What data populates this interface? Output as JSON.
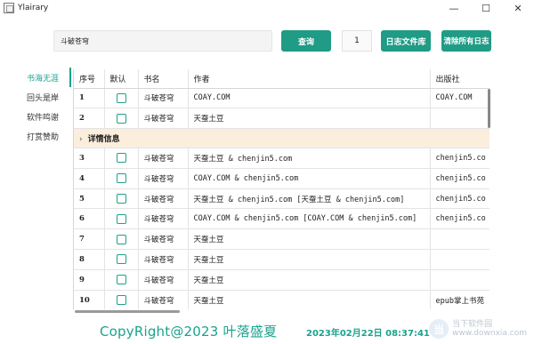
{
  "window": {
    "title": "Ylairary",
    "minimize": "—",
    "maximize": "☐",
    "close": "✕"
  },
  "toolbar": {
    "search_value": "斗破苍穹",
    "query_label": "查询",
    "page_value": "1",
    "log_label": "日志文件库",
    "clear_label": "清除所有日志"
  },
  "sidebar": {
    "items": [
      {
        "label": "书海无涯",
        "active": true
      },
      {
        "label": "回头是岸",
        "active": false
      },
      {
        "label": "软件鸣谢",
        "active": false
      },
      {
        "label": "打赏赞助",
        "active": false
      }
    ]
  },
  "table": {
    "headers": [
      "序号",
      "默认",
      "书名",
      "作者",
      "出版社"
    ],
    "rows": [
      {
        "no": "1",
        "book": "斗破苍穹",
        "author": "COAY.COM",
        "publisher": "COAY.COM"
      },
      {
        "no": "2",
        "book": "斗破苍穹",
        "author": "天蚕土豆",
        "publisher": ""
      },
      {
        "no": "3",
        "book": "斗破苍穹",
        "author": "天蚕土豆 & chenjin5.com",
        "publisher": "chenjin5.co"
      },
      {
        "no": "4",
        "book": "斗破苍穹",
        "author": "COAY.COM & chenjin5.com",
        "publisher": "chenjin5.co"
      },
      {
        "no": "5",
        "book": "斗破苍穹",
        "author": "天蚕土豆 & chenjin5.com [天蚕土豆 & chenjin5.com]",
        "publisher": "chenjin5.co"
      },
      {
        "no": "6",
        "book": "斗破苍穹",
        "author": "COAY.COM & chenjin5.com [COAY.COM & chenjin5.com]",
        "publisher": "chenjin5.co"
      },
      {
        "no": "7",
        "book": "斗破苍穹",
        "author": "天蚕土豆",
        "publisher": ""
      },
      {
        "no": "8",
        "book": "斗破苍穹",
        "author": "天蚕土豆",
        "publisher": ""
      },
      {
        "no": "9",
        "book": "斗破苍穹",
        "author": "天蚕土豆",
        "publisher": ""
      },
      {
        "no": "10",
        "book": "斗破苍穹",
        "author": "天蚕土豆",
        "publisher": "epub掌上书苑"
      }
    ],
    "detail_label": "详情信息"
  },
  "footer": {
    "copyright": "CopyRight@2023 叶落盛夏",
    "timestamp": "2023年02月22日 08:37:41"
  },
  "watermark": {
    "logo": "当",
    "line1": "当下软件园",
    "line2": "www.downxia.com"
  },
  "colors": {
    "accent": "#1f9b86",
    "detail_bg": "#fbeedd"
  }
}
